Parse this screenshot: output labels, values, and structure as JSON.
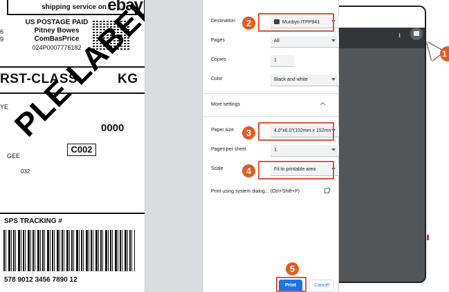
{
  "label": {
    "ebay_text": "shipping service on",
    "ebay_logo": "ebay",
    "postage_lines": [
      "US POSTAGE PAID",
      "Pitney Bowes",
      "ComBasPrice",
      "024P0007776182"
    ],
    "left_digits": [
      "6",
      "9"
    ],
    "service_line": "RST-CLASS",
    "service_suffix": "KG",
    "ye_text": "YE",
    "zeros": "0000",
    "box_code": "C002",
    "gee_text": "GEE",
    "n32_text": "032",
    "tracking_title": "SPS TRACKING #",
    "tracking_number": "578 9012 3456 7890 12",
    "watermark": "PLE LABEL"
  },
  "dialog": {
    "destination": {
      "label": "Destination",
      "value": "Munbyn ITPP941"
    },
    "pages": {
      "label": "Pages",
      "value": "All"
    },
    "copies": {
      "label": "Copies",
      "value": "1"
    },
    "color": {
      "label": "Color",
      "value": "Black and white"
    },
    "more_settings": "More settings",
    "paper_size": {
      "label": "Paper size",
      "value": "4.0\"x6.0\"(102mm x 152mn"
    },
    "pages_per_sheet": {
      "label": "Pages per sheet",
      "value": "1"
    },
    "scale": {
      "label": "Scale",
      "value": "Fit to printable area"
    },
    "system_dialog": "Print using system dialog... (Ctrl+Shift+P)",
    "print_button": "Print",
    "cancel_button": "Cancel"
  },
  "badges": {
    "b1": "1",
    "b2": "2",
    "b3": "3",
    "b4": "4",
    "b5": "5"
  },
  "colors": {
    "accent": "#e85a1f",
    "highlight": "#e0533b",
    "primary_button": "#1a73e8",
    "viewer_bg": "#525659"
  },
  "icons": {
    "download": "download-icon",
    "print": "printer-icon",
    "cursor": "mouse-cursor-icon",
    "external": "open-external-icon"
  }
}
